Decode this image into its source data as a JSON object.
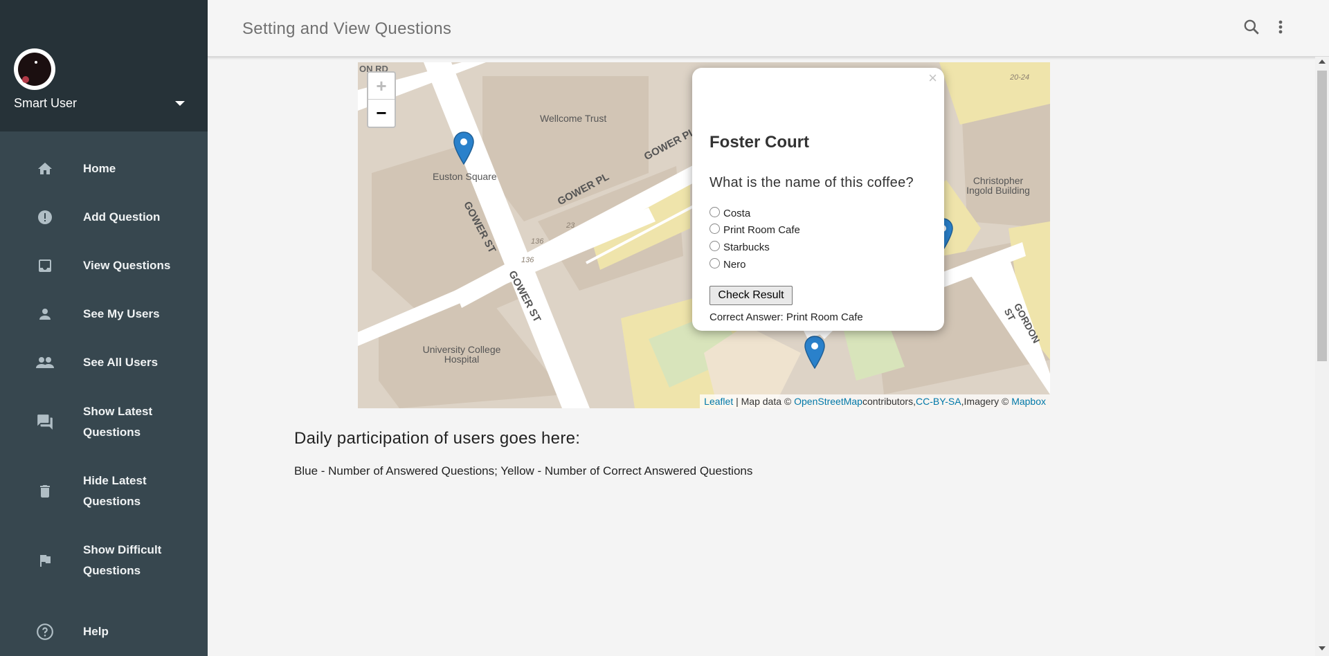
{
  "sidebar": {
    "username": "Smart User",
    "items": [
      {
        "label": "Home",
        "icon": "home-icon"
      },
      {
        "label": "Add Question",
        "icon": "alert-icon"
      },
      {
        "label": "View Questions",
        "icon": "inbox-icon"
      },
      {
        "label": "See My Users",
        "icon": "person-icon"
      },
      {
        "label": "See All Users",
        "icon": "people-icon"
      },
      {
        "label": "Show Latest Questions",
        "icon": "forum-icon"
      },
      {
        "label": "Hide Latest Questions",
        "icon": "trash-icon"
      },
      {
        "label": "Show Difficult Questions",
        "icon": "flag-icon"
      },
      {
        "label": "Help",
        "icon": "help-icon"
      }
    ]
  },
  "header": {
    "title": "Setting and View Questions"
  },
  "map": {
    "zoom_in": "+",
    "zoom_out": "−",
    "labels": {
      "wellcome": "Wellcome Trust",
      "euston": "Euston Square",
      "gower_pl_1": "GOWER PL",
      "gower_pl_2": "GOWER PL",
      "gower_st_1": "GOWER ST",
      "gower_st_2": "GOWER ST",
      "gordon_st": "GORDON ST",
      "ucl_hospital": "University College Hospital",
      "christopher": "Christopher Ingold Building",
      "num_136a": "136",
      "num_136b": "136",
      "num_23": "23",
      "num_2024": "20-24",
      "on_rd": "ON RD"
    },
    "attribution": {
      "leaflet": "Leaflet",
      "map_data": " | Map data © ",
      "osm": "OpenStreetMap",
      "contributors": "contributors,",
      "ccbysa": "CC-BY-SA",
      "imagery": ",Imagery © ",
      "mapbox": "Mapbox"
    },
    "popup": {
      "close": "×",
      "place": "Foster Court",
      "question": "What is the name of this coffee?",
      "options": [
        "Costa",
        "Print Room Cafe",
        "Starbucks",
        "Nero"
      ],
      "button": "Check Result",
      "answer": "Correct Answer: Print Room Cafe"
    }
  },
  "main": {
    "heading": "Daily participation of users goes here:",
    "legend": "Blue - Number of Answered Questions; Yellow - Number of Correct Answered Questions"
  },
  "colors": {
    "sidebar_bg": "#37474f",
    "sidebar_header_bg": "#263238",
    "marker_blue": "#2a81cb",
    "link_blue": "#0078a8"
  }
}
